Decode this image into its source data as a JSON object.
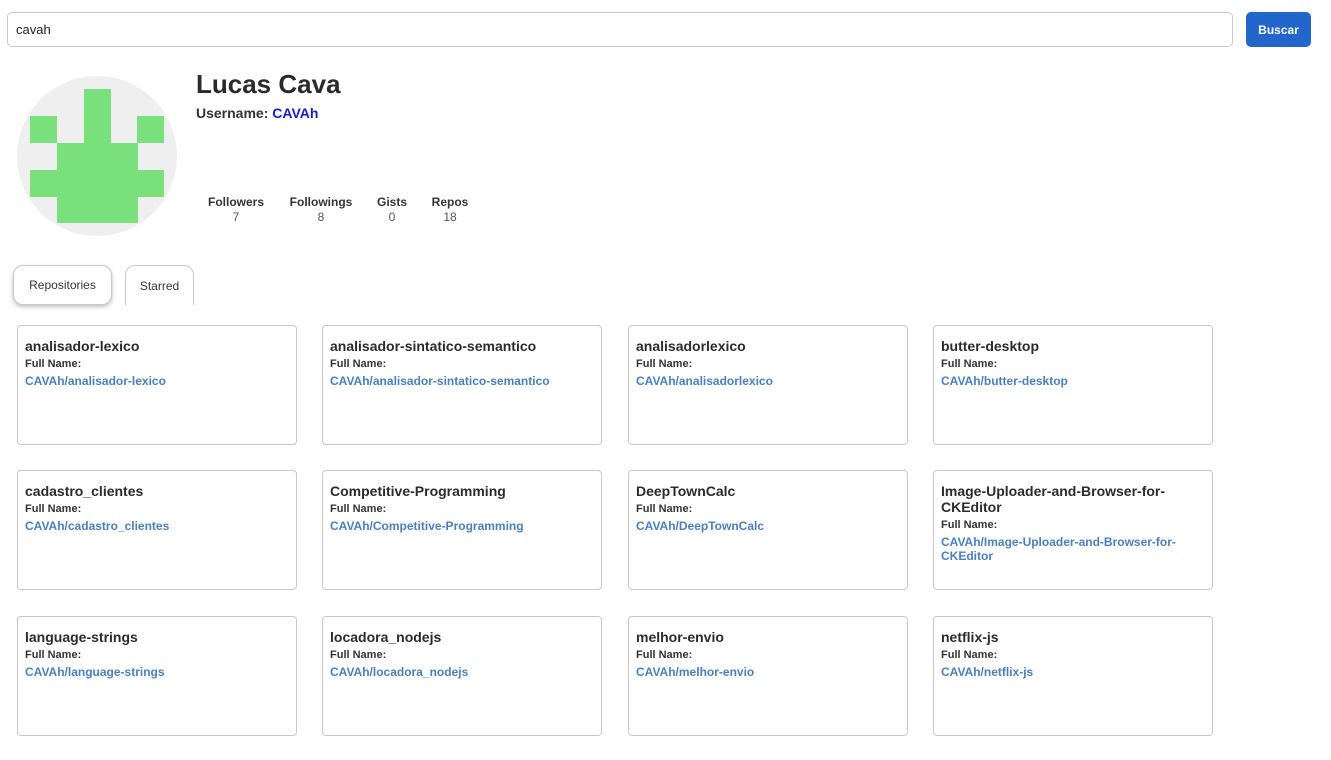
{
  "search": {
    "value": "cavah",
    "button_label": "Buscar"
  },
  "profile": {
    "name": "Lucas Cava",
    "username_label": "Username:",
    "username": "CAVAh"
  },
  "stats": [
    {
      "label": "Followers",
      "value": "7"
    },
    {
      "label": "Followings",
      "value": "8"
    },
    {
      "label": "Gists",
      "value": "0"
    },
    {
      "label": "Repos",
      "value": "18"
    }
  ],
  "tabs": [
    {
      "label": "Repositories",
      "active": true
    },
    {
      "label": "Starred",
      "active": false
    }
  ],
  "repo_card": {
    "fullname_label": "Full Name:"
  },
  "repos": [
    {
      "name": "analisador-lexico",
      "full_name": "CAVAh/analisador-lexico"
    },
    {
      "name": "analisador-sintatico-semantico",
      "full_name": "CAVAh/analisador-sintatico-semantico"
    },
    {
      "name": "analisadorlexico",
      "full_name": "CAVAh/analisadorlexico"
    },
    {
      "name": "butter-desktop",
      "full_name": "CAVAh/butter-desktop"
    },
    {
      "name": "cadastro_clientes",
      "full_name": "CAVAh/cadastro_clientes"
    },
    {
      "name": "Competitive-Programming",
      "full_name": "CAVAh/Competitive-Programming"
    },
    {
      "name": "DeepTownCalc",
      "full_name": "CAVAh/DeepTownCalc"
    },
    {
      "name": "Image-Uploader-and-Browser-for-CKEditor",
      "full_name": "CAVAh/Image-Uploader-and-Browser-for-CKEditor"
    },
    {
      "name": "language-strings",
      "full_name": "CAVAh/language-strings"
    },
    {
      "name": "locadora_nodejs",
      "full_name": "CAVAh/locadora_nodejs"
    },
    {
      "name": "melhor-envio",
      "full_name": "CAVAh/melhor-envio"
    },
    {
      "name": "netflix-js",
      "full_name": "CAVAh/netflix-js"
    }
  ],
  "colors": {
    "accent": "#2266cc",
    "link": "#4a7fbf",
    "username_link": "#1a1acc",
    "avatar_pattern": "#79e07c"
  }
}
